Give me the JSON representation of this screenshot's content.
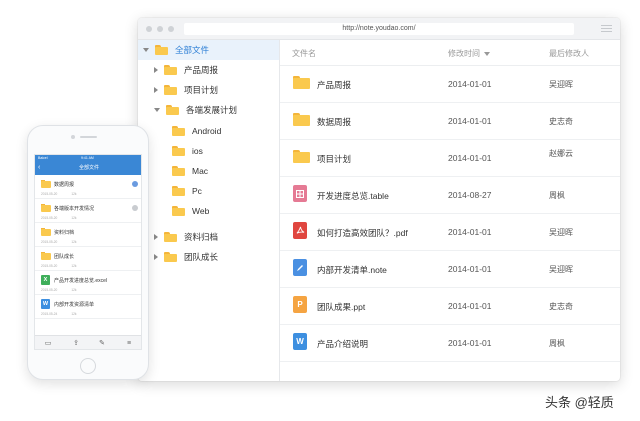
{
  "window": {
    "url": "http://note.youdao.com/"
  },
  "tree": {
    "root": "全部文件",
    "items": [
      {
        "label": "产品周报"
      },
      {
        "label": "项目计划"
      },
      {
        "label": "各端发展计划"
      },
      {
        "label": "Android"
      },
      {
        "label": "ios"
      },
      {
        "label": "Mac"
      },
      {
        "label": "Pc"
      },
      {
        "label": "Web"
      },
      {
        "label": "资料归档"
      },
      {
        "label": "团队成长"
      }
    ]
  },
  "list": {
    "headers": {
      "name": "文件名",
      "modified": "修改时间",
      "modifier": "最后修改人"
    },
    "rows": [
      {
        "name": "产品周报",
        "date": "2014-01-01",
        "owner": "吴迎晖",
        "icon": "folder-icon"
      },
      {
        "name": "数据周报",
        "date": "2014-01-01",
        "owner": "史志奇",
        "icon": "folder-icon"
      },
      {
        "name": "项目计划",
        "date": "2014-01-01",
        "owner": "赵娜云",
        "icon": "folder-icon"
      },
      {
        "name": "开发进度总览.table",
        "date": "2014-08-27",
        "owner": "周枫",
        "icon": "table-icon",
        "color": "#e57a94"
      },
      {
        "name": "如何打造高效团队？.pdf",
        "date": "2014-01-01",
        "owner": "吴迎晖",
        "icon": "pdf-icon",
        "color": "#e0463f"
      },
      {
        "name": "内部开发清单.note",
        "date": "2014-01-01",
        "owner": "吴迎晖",
        "icon": "note-icon",
        "color": "#4a90e2"
      },
      {
        "name": "团队成果.ppt",
        "date": "2014-01-01",
        "owner": "史志奇",
        "icon": "ppt-icon",
        "color": "#f5a442",
        "glyph": "P"
      },
      {
        "name": "产品介绍说明",
        "date": "2014-01-01",
        "owner": "周枫",
        "icon": "word-icon",
        "color": "#3d8fe0",
        "glyph": "W"
      }
    ]
  },
  "phone": {
    "carrier": "Baicel",
    "time": "9:41 AM",
    "title": "全部文件",
    "rows": [
      {
        "name": "数据周报",
        "date": "2015-05-20",
        "size": "12k",
        "icon": "folder-icon",
        "badge": "#6a9be0"
      },
      {
        "name": "各端版本开发情况",
        "date": "2015-05-20",
        "size": "12k",
        "icon": "folder-icon",
        "badge": "#c9ccd0"
      },
      {
        "name": "资料归档",
        "date": "2015-05-20",
        "size": "12k",
        "icon": "folder-icon"
      },
      {
        "name": "团队成长",
        "date": "2015-05-20",
        "size": "12k",
        "icon": "folder-icon"
      },
      {
        "name": "产品开发进度总览.excel",
        "date": "2015-05-20",
        "size": "12k",
        "icon": "excel-icon",
        "color": "#3fae5a",
        "glyph": "X"
      },
      {
        "name": "内部开发资源清单",
        "date": "2015-05-24",
        "size": "12k",
        "icon": "word-icon",
        "color": "#3d8fe0",
        "glyph": "W"
      }
    ]
  },
  "watermark": "头条 @轻质",
  "colors": {
    "accent": "#3a87d5",
    "folder": "#fac94e",
    "selected_bg": "#e9f2fb"
  }
}
